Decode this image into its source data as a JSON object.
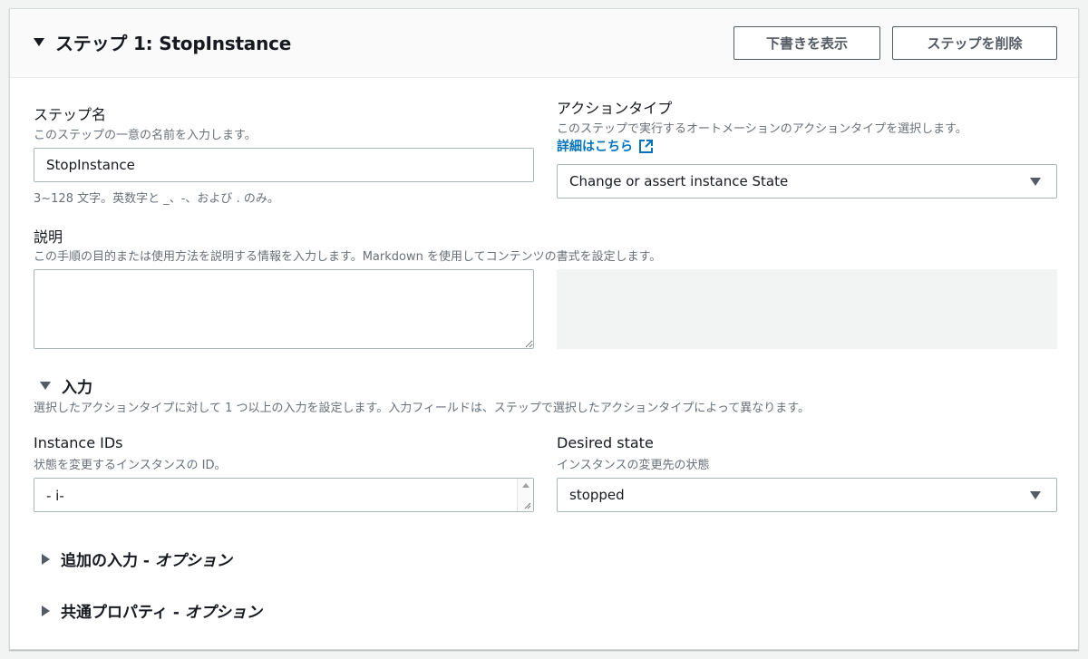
{
  "header": {
    "title": "ステップ 1: StopInstance",
    "view_draft_label": "下書きを表示",
    "delete_step_label": "ステップを削除"
  },
  "step_name": {
    "label": "ステップ名",
    "description": "このステップの一意の名前を入力します。",
    "value": "StopInstance",
    "hint": "3~128 文字。英数字と _、-、および . のみ。"
  },
  "action_type": {
    "label": "アクションタイプ",
    "description": "このステップで実行するオートメーションのアクションタイプを選択します。",
    "learn_more": "詳細はこちら",
    "selected": "Change or assert instance State"
  },
  "description_field": {
    "label": "説明",
    "description": "この手順の目的または使用方法を説明する情報を入力します。Markdown を使用してコンテンツの書式を設定します。",
    "value": ""
  },
  "inputs_section": {
    "title": "入力",
    "description": "選択したアクションタイプに対して 1 つ以上の入力を設定します。入力フィールドは、ステップで選択したアクションタイプによって異なります。"
  },
  "instance_ids": {
    "label": "Instance IDs",
    "description": "状態を変更するインスタンスの ID。",
    "value": "- i-"
  },
  "desired_state": {
    "label": "Desired state",
    "description": "インスタンスの変更先の状態",
    "selected": "stopped"
  },
  "additional_inputs": {
    "title": "追加の入力",
    "suffix": "オプション"
  },
  "common_properties": {
    "title": "共通プロパティ",
    "suffix": "オプション"
  },
  "colors": {
    "link": "#0073bb",
    "border": "#aab7b8",
    "header_bg": "#fafafa",
    "page_bg": "#f2f3f3"
  }
}
